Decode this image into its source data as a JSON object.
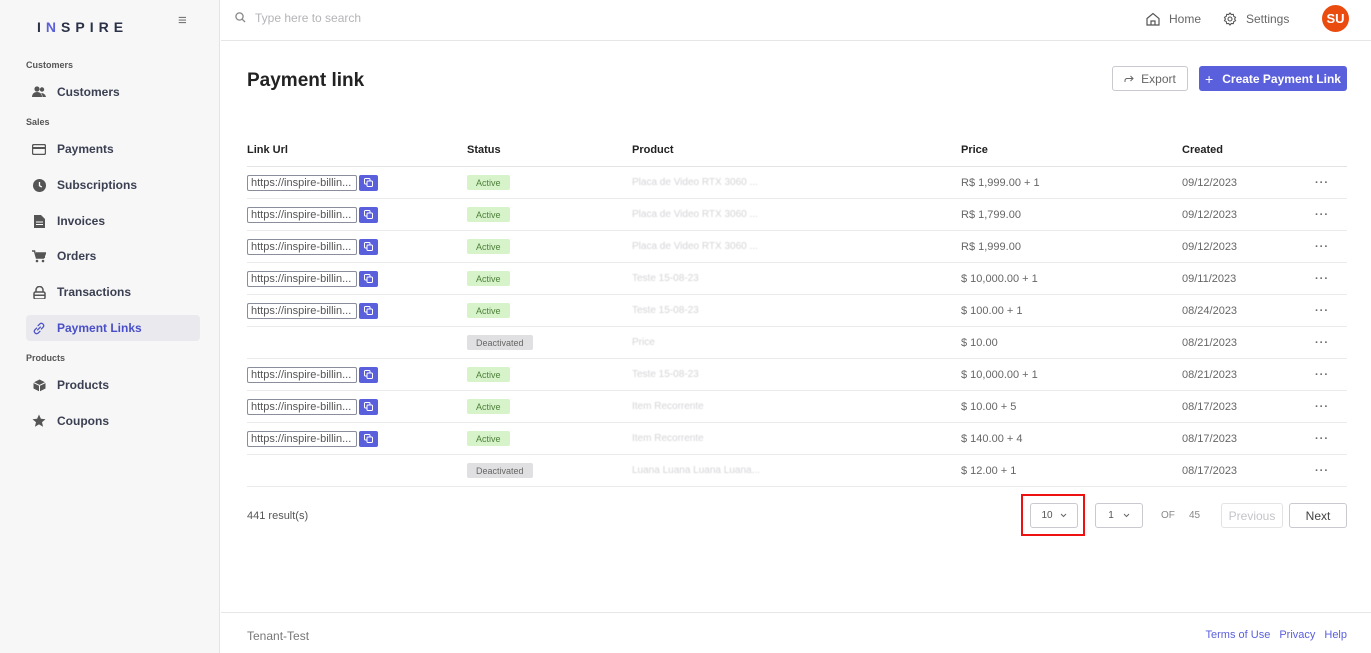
{
  "brand": {
    "prefix": "I",
    "n": "N",
    "rest": "SPIRE"
  },
  "sidebar": {
    "sections": [
      {
        "label": "Customers"
      },
      {
        "label": "Sales"
      },
      {
        "label": "Products"
      }
    ],
    "items": [
      {
        "label": "Customers",
        "icon": "users-icon"
      },
      {
        "label": "Payments",
        "icon": "credit-card-icon"
      },
      {
        "label": "Subscriptions",
        "icon": "clock-icon"
      },
      {
        "label": "Invoices",
        "icon": "document-icon"
      },
      {
        "label": "Orders",
        "icon": "cart-icon"
      },
      {
        "label": "Transactions",
        "icon": "lock-icon"
      },
      {
        "label": "Payment Links",
        "icon": "link-icon",
        "active": true
      },
      {
        "label": "Products",
        "icon": "box-icon"
      },
      {
        "label": "Coupons",
        "icon": "star-icon"
      }
    ]
  },
  "topbar": {
    "search_placeholder": "Type here to search",
    "home_label": "Home",
    "settings_label": "Settings",
    "avatar_initials": "SU"
  },
  "page": {
    "title": "Payment link",
    "export_label": "Export",
    "create_label": "Create Payment Link"
  },
  "table": {
    "headers": [
      "Link Url",
      "Status",
      "Product",
      "Price",
      "Created"
    ],
    "rows": [
      {
        "link": "https://inspire-billin...",
        "status": "Active",
        "product": "Placa de Video RTX 3060 ...",
        "price": "R$ 1,999.00 + 1",
        "created": "09/12/2023"
      },
      {
        "link": "https://inspire-billin...",
        "status": "Active",
        "product": "Placa de Video RTX 3060 ...",
        "price": "R$ 1,799.00",
        "created": "09/12/2023"
      },
      {
        "link": "https://inspire-billin...",
        "status": "Active",
        "product": "Placa de Video RTX 3060 ...",
        "price": "R$ 1,999.00",
        "created": "09/12/2023"
      },
      {
        "link": "https://inspire-billin...",
        "status": "Active",
        "product": "Teste 15-08-23",
        "price": "$ 10,000.00 + 1",
        "created": "09/11/2023"
      },
      {
        "link": "https://inspire-billin...",
        "status": "Active",
        "product": "Teste 15-08-23",
        "price": "$ 100.00 + 1",
        "created": "08/24/2023"
      },
      {
        "link": "",
        "status": "Deactivated",
        "product": "Price",
        "price": "$ 10.00",
        "created": "08/21/2023"
      },
      {
        "link": "https://inspire-billin...",
        "status": "Active",
        "product": "Teste 15-08-23",
        "price": "$ 10,000.00 + 1",
        "created": "08/21/2023"
      },
      {
        "link": "https://inspire-billin...",
        "status": "Active",
        "product": "Item Recorrente",
        "price": "$ 10.00 + 5",
        "created": "08/17/2023"
      },
      {
        "link": "https://inspire-billin...",
        "status": "Active",
        "product": "Item Recorrente",
        "price": "$ 140.00 + 4",
        "created": "08/17/2023"
      },
      {
        "link": "",
        "status": "Deactivated",
        "product": "Luana Luana Luana Luana...",
        "price": "$ 12.00 + 1",
        "created": "08/17/2023"
      }
    ],
    "more_label": "···"
  },
  "pagination": {
    "results": "441 result(s)",
    "page_size": "10",
    "page": "1",
    "of_label": "OF",
    "total_pages": "45",
    "prev_label": "Previous",
    "next_label": "Next"
  },
  "footer": {
    "tenant": "Tenant-Test",
    "links": [
      "Terms of Use",
      "Privacy",
      "Help"
    ]
  },
  "colors": {
    "accent": "#5a5fdc",
    "avatar": "#ea4c0f",
    "active_badge": "#d7f3c9",
    "highlight": "#ee1111"
  }
}
